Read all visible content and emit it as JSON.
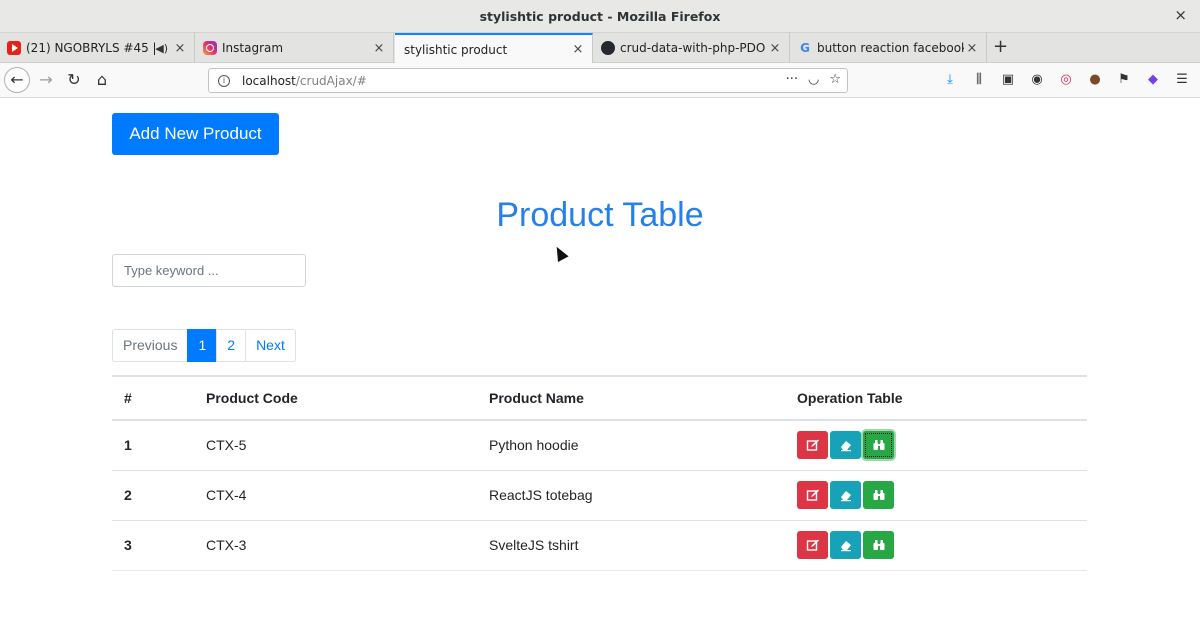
{
  "window": {
    "title": "stylishtic product - Mozilla Firefox",
    "close_glyph": "×"
  },
  "tabs": [
    {
      "label": "(21) NGOBRYLS #45 |",
      "icon": "youtube-icon",
      "audio": "◀)",
      "active": false
    },
    {
      "label": "Instagram",
      "icon": "instagram-icon",
      "active": false
    },
    {
      "label": "stylishtic product",
      "icon": "",
      "active": true
    },
    {
      "label": "crud-data-with-php-PDO",
      "icon": "github-icon",
      "active": false
    },
    {
      "label": "button reaction facebook",
      "icon": "google-icon",
      "active": false
    }
  ],
  "tab_close_glyph": "×",
  "new_tab_glyph": "+",
  "nav": {
    "back": "←",
    "forward": "→",
    "reload": "↻",
    "home": "⌂",
    "url_host": "localhost",
    "url_path": "/crudAjax/#",
    "page_actions": "···",
    "pocket": "◡",
    "bookmark": "☆",
    "toolbar": {
      "download": "⤓",
      "library": "⫼",
      "sidebar": "▣",
      "account": "◉",
      "record": "◎",
      "cookie": "●",
      "flag": "⚑",
      "extension": "◆",
      "menu": "☰"
    }
  },
  "page": {
    "add_button": "Add New Product",
    "heading": "Product Table",
    "search_placeholder": "Type keyword ...",
    "pagination": {
      "previous": "Previous",
      "pages": [
        "1",
        "2"
      ],
      "active_page": "1",
      "next": "Next"
    }
  },
  "table": {
    "headers": [
      "#",
      "Product Code",
      "Product Name",
      "Operation Table"
    ],
    "rows": [
      {
        "num": "1",
        "code": "CTX-5",
        "name": "Python hoodie"
      },
      {
        "num": "2",
        "code": "CTX-4",
        "name": "ReactJS totebag"
      },
      {
        "num": "3",
        "code": "CTX-3",
        "name": "SvelteJS tshirt"
      }
    ],
    "operation_icons": [
      "edit-icon",
      "eraser-icon",
      "binoculars-icon"
    ]
  },
  "colors": {
    "primary": "#007bff",
    "heading": "#2680e8",
    "danger": "#dc3545",
    "info": "#17a2b8",
    "success": "#28a745"
  }
}
